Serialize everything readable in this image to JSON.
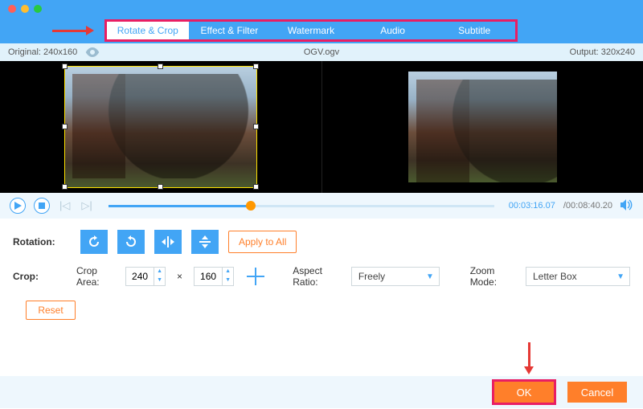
{
  "tabs": [
    "Rotate & Crop",
    "Effect & Filter",
    "Watermark",
    "Audio",
    "Subtitle"
  ],
  "active_tab_index": 0,
  "info": {
    "original_label": "Original: 240x160",
    "filename": "OGV.ogv",
    "output_label": "Output: 320x240"
  },
  "playback": {
    "current": "00:03:16.07",
    "total": "/00:08:40.20",
    "progress_pct": 37
  },
  "rotation": {
    "label": "Rotation:",
    "apply_all": "Apply to All"
  },
  "crop": {
    "label": "Crop:",
    "area_label": "Crop Area:",
    "width": "240",
    "height": "160",
    "times": "×",
    "aspect_label": "Aspect Ratio:",
    "aspect_value": "Freely",
    "zoom_label": "Zoom Mode:",
    "zoom_value": "Letter Box",
    "reset": "Reset"
  },
  "buttons": {
    "ok": "OK",
    "cancel": "Cancel"
  }
}
